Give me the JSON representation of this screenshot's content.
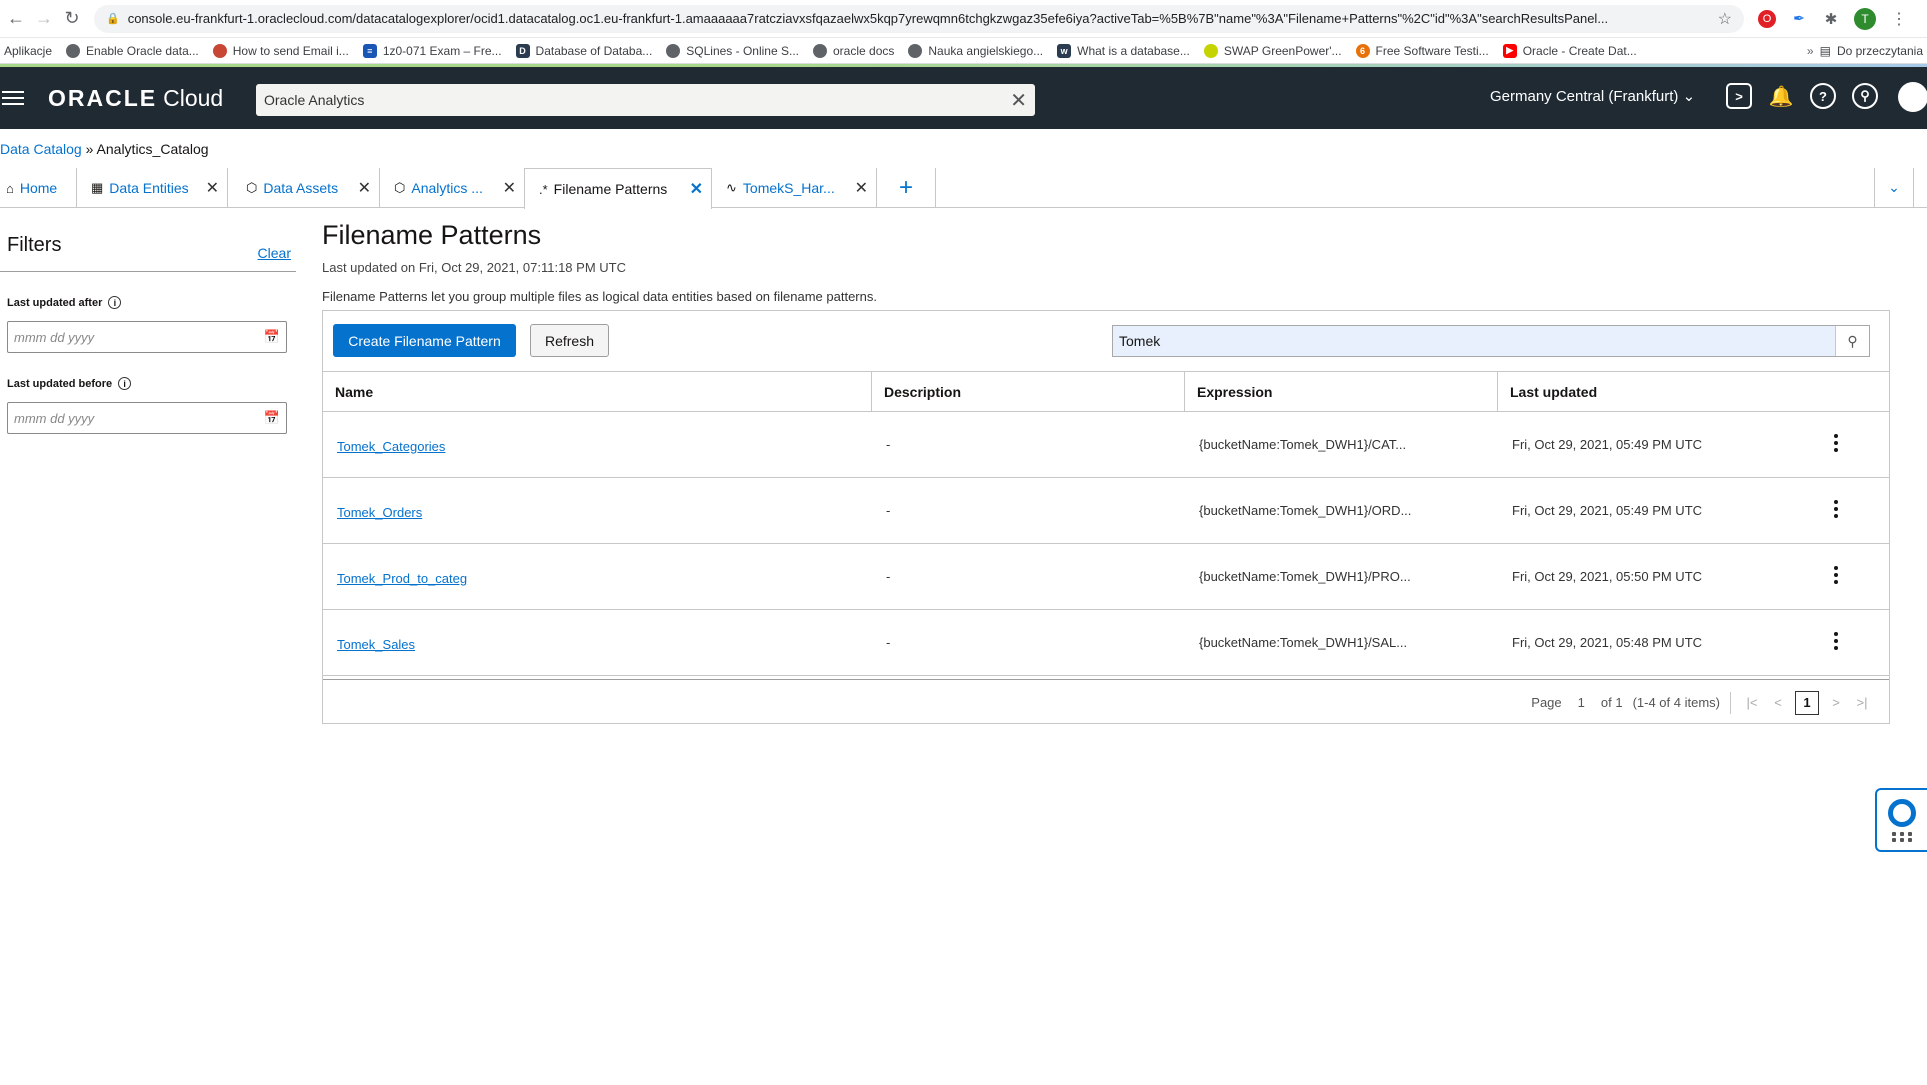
{
  "browser": {
    "url": "console.eu-frankfurt-1.oraclecloud.com/datacatalogexplorer/ocid1.datacatalog.oc1.eu-frankfurt-1.amaaaaaa7ratcziavxsfqazaelwx5kqp7yrewqmn6tchgkzwgaz35efe6iya?activeTab=%5B%7B\"name\"%3A\"Filename+Patterns\"%2C\"id\"%3A\"searchResultsPanel...",
    "avatar_letter": "T",
    "bookmarks": [
      {
        "label": "Aplikacje",
        "icon": "apps-grid-icon"
      },
      {
        "label": "Enable Oracle data...",
        "icon": "globe-icon"
      },
      {
        "label": "How to send Email i...",
        "icon": "red-circle-icon"
      },
      {
        "label": "1z0-071 Exam – Fre...",
        "icon": "blue-bars-icon"
      },
      {
        "label": "Database of Databa...",
        "icon": "db-icon"
      },
      {
        "label": "SQLines - Online S...",
        "icon": "globe-icon"
      },
      {
        "label": "oracle docs",
        "icon": "globe-icon"
      },
      {
        "label": "Nauka angielskiego...",
        "icon": "globe-icon"
      },
      {
        "label": "What is a database...",
        "icon": "site-icon"
      },
      {
        "label": "SWAP GreenPower'...",
        "icon": "green-icon"
      },
      {
        "label": "Free Software Testi...",
        "icon": "orange-icon"
      },
      {
        "label": "Oracle - Create Dat...",
        "icon": "youtube-icon"
      }
    ],
    "bookmarks_overflow": "»",
    "reading_list": "Do przeczytania"
  },
  "header": {
    "logo_brand": "ORACLE",
    "logo_product": "Cloud",
    "search_value": "Oracle Analytics",
    "region": "Germany Central (Frankfurt)"
  },
  "breadcrumb": {
    "root": "Data Catalog",
    "separator": "»",
    "current": "Analytics_Catalog"
  },
  "tabs": [
    {
      "label": "Home",
      "icon": "home-icon"
    },
    {
      "label": "Data Entities",
      "icon": "table-icon"
    },
    {
      "label": "Data Assets",
      "icon": "cube-icon"
    },
    {
      "label": "Analytics ...",
      "icon": "cube-icon"
    },
    {
      "label": "Filename Patterns",
      "icon": "pattern-icon"
    },
    {
      "label": "TomekS_Har...",
      "icon": "activity-icon"
    }
  ],
  "filters": {
    "title": "Filters",
    "clear": "Clear",
    "after_label": "Last updated after",
    "before_label": "Last updated before",
    "date_placeholder": "mmm dd yyyy"
  },
  "main": {
    "title": "Filename Patterns",
    "last_updated": "Last updated on Fri, Oct 29, 2021, 07:11:18 PM UTC",
    "description": "Filename Patterns let you group multiple files as logical data entities based on filename patterns.",
    "create_button": "Create Filename Pattern",
    "refresh_button": "Refresh",
    "search_value": "Tomek",
    "columns": [
      "Name",
      "Description",
      "Expression",
      "Last updated"
    ],
    "rows": [
      {
        "name": "Tomek_Categories",
        "description": "-",
        "expression": "{bucketName:Tomek_DWH1}/CAT...",
        "updated": "Fri, Oct 29, 2021, 05:49 PM UTC"
      },
      {
        "name": "Tomek_Orders",
        "description": "-",
        "expression": "{bucketName:Tomek_DWH1}/ORD...",
        "updated": "Fri, Oct 29, 2021, 05:49 PM UTC"
      },
      {
        "name": "Tomek_Prod_to_categ",
        "description": "-",
        "expression": "{bucketName:Tomek_DWH1}/PRO...",
        "updated": "Fri, Oct 29, 2021, 05:50 PM UTC"
      },
      {
        "name": "Tomek_Sales",
        "description": "-",
        "expression": "{bucketName:Tomek_DWH1}/SAL...",
        "updated": "Fri, Oct 29, 2021, 05:48 PM UTC"
      }
    ],
    "pager": {
      "page_word": "Page",
      "page_num": "1",
      "of": "of 1",
      "range": "(1-4 of 4 items)",
      "current": "1"
    }
  }
}
